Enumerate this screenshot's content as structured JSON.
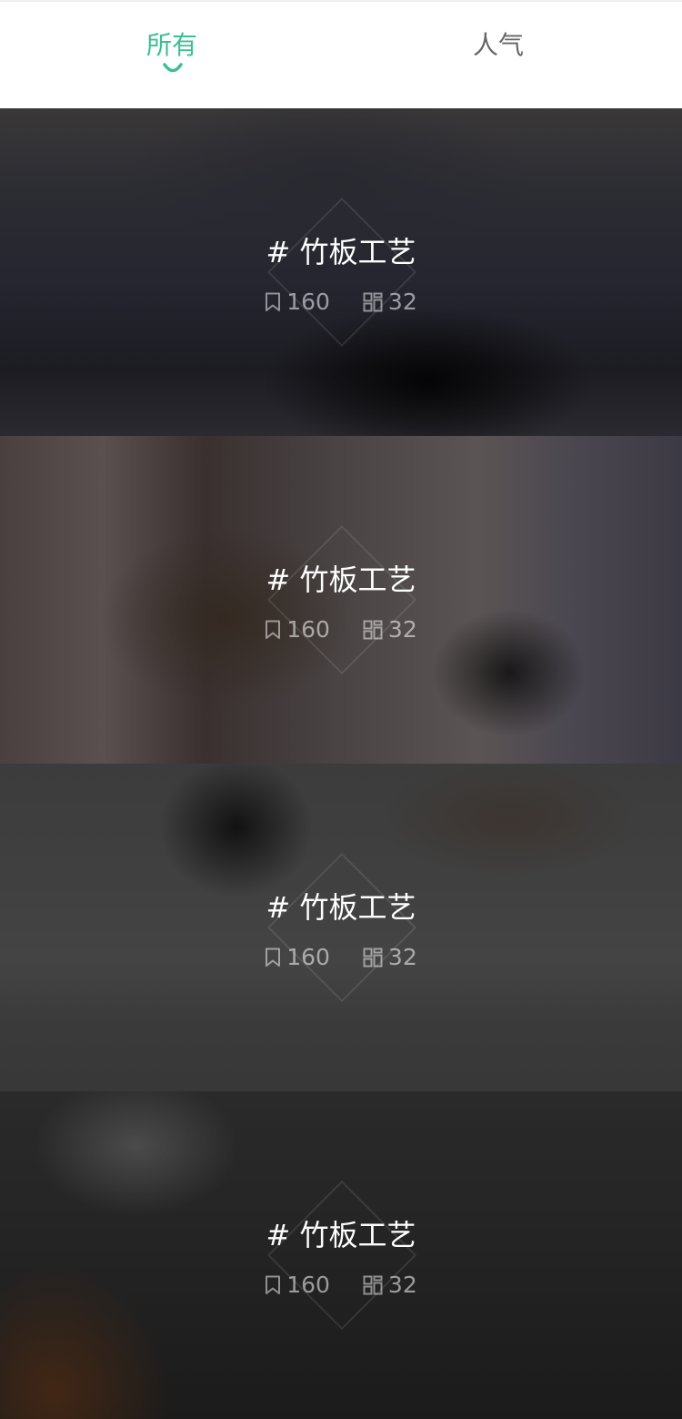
{
  "tabs": [
    {
      "label": "所有",
      "active": true
    },
    {
      "label": "人气",
      "active": false
    }
  ],
  "accent_color": "#3dbf94",
  "cards": [
    {
      "title": "# 竹板工艺",
      "bookmarks": "160",
      "items": "32",
      "stat_icons": [
        "bookmark-icon",
        "grid-icon"
      ]
    },
    {
      "title": "# 竹板工艺",
      "bookmarks": "160",
      "items": "32",
      "stat_icons": [
        "bookmark-icon",
        "grid-icon"
      ]
    },
    {
      "title": "# 竹板工艺",
      "bookmarks": "160",
      "items": "32",
      "stat_icons": [
        "bookmark-icon",
        "grid-icon"
      ]
    },
    {
      "title": "# 竹板工艺",
      "bookmarks": "160",
      "items": "32",
      "stat_icons": [
        "bookmark-icon",
        "grid-icon"
      ]
    }
  ]
}
